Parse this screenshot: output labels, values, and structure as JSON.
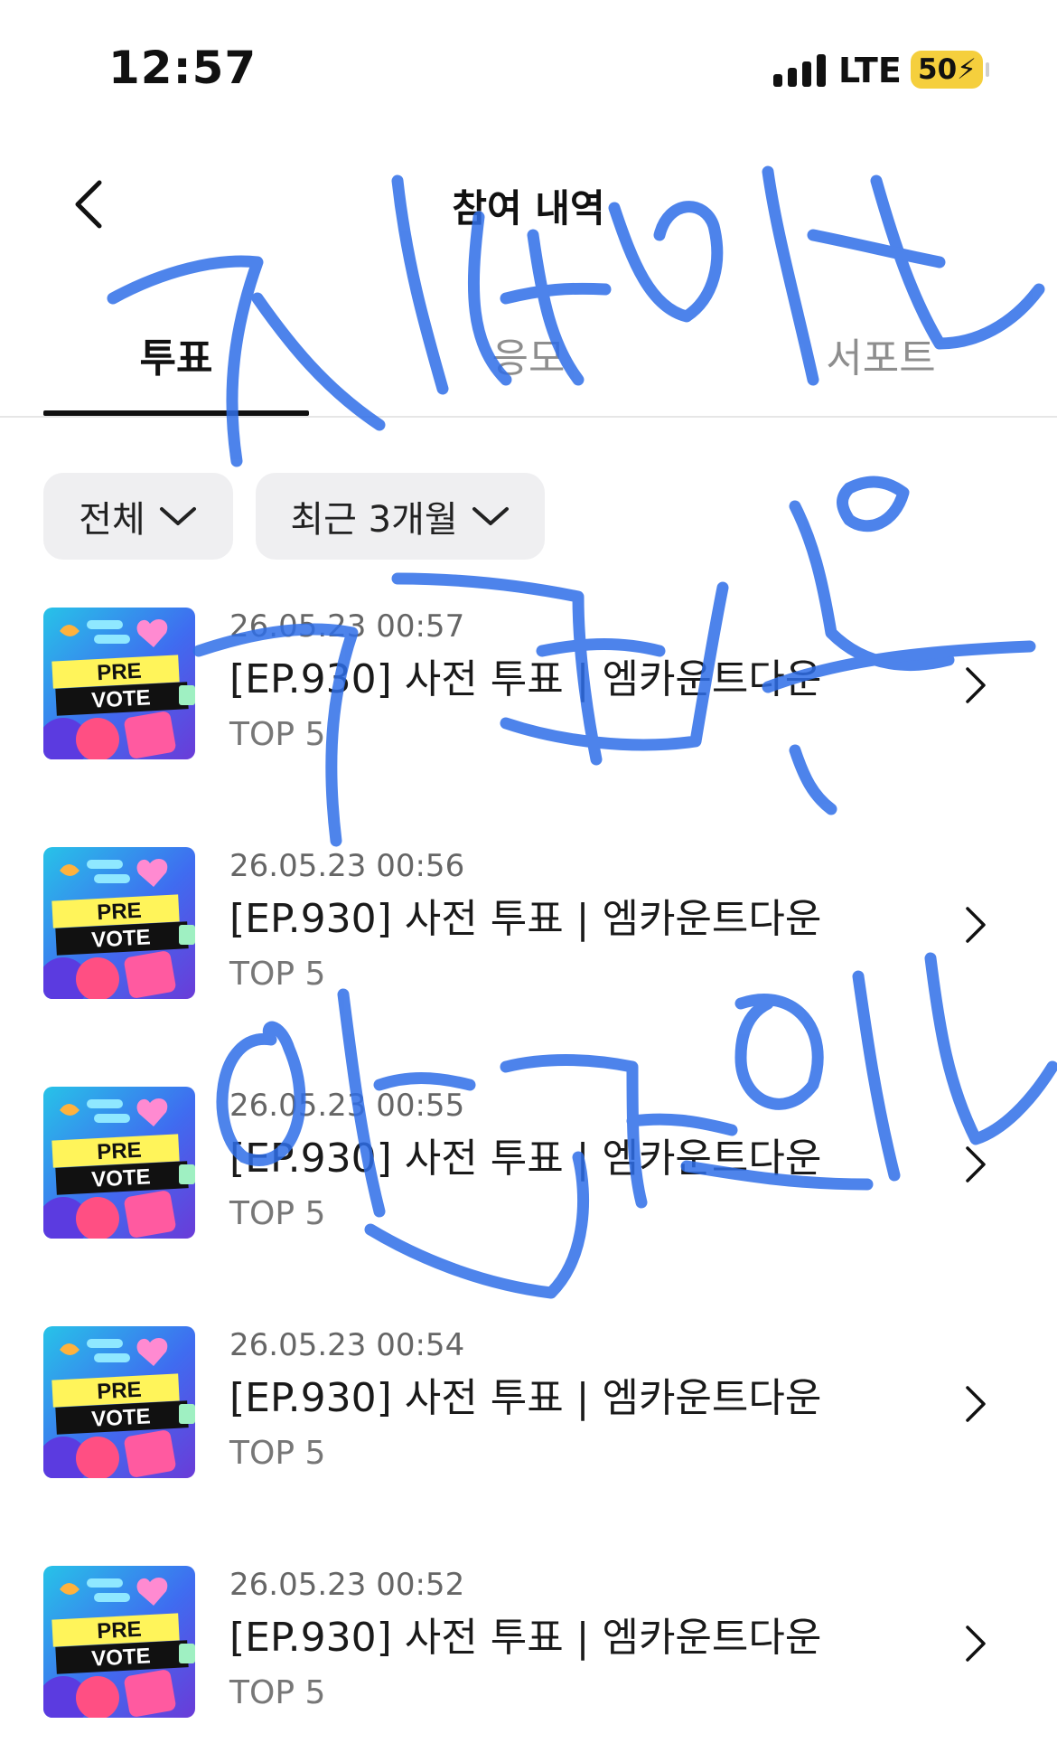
{
  "status_bar": {
    "time": "12:57",
    "network": "LTE",
    "battery": "50"
  },
  "header": {
    "title": "참여 내역",
    "back_icon": "chevron-left-icon"
  },
  "tabs": [
    {
      "label": "투표",
      "active": true
    },
    {
      "label": "응모",
      "active": false
    },
    {
      "label": "서포트",
      "active": false
    }
  ],
  "filters": {
    "category": "전체",
    "period": "최근 3개월"
  },
  "items": [
    {
      "date": "26.05.23 00:57",
      "title": "[EP.930] 사전 투표 | 엠카운트다운",
      "subtitle": "TOP 5"
    },
    {
      "date": "26.05.23 00:56",
      "title": "[EP.930] 사전 투표 | 엠카운트다운",
      "subtitle": "TOP 5"
    },
    {
      "date": "26.05.23 00:55",
      "title": "[EP.930] 사전 투표 | 엠카운트다운",
      "subtitle": "TOP 5"
    },
    {
      "date": "26.05.23 00:54",
      "title": "[EP.930] 사전 투표 | 엠카운트다운",
      "subtitle": "TOP 5"
    },
    {
      "date": "26.05.23 00:52",
      "title": "[EP.930] 사전 투표 | 엠카운트다운",
      "subtitle": "TOP 5"
    }
  ],
  "thumbnail": {
    "line1": "PRE",
    "line2": "VOTE"
  },
  "colors": {
    "scribble": "#2f6ee8",
    "chip_bg": "#efeff1",
    "battery": "#f5cf3d"
  }
}
